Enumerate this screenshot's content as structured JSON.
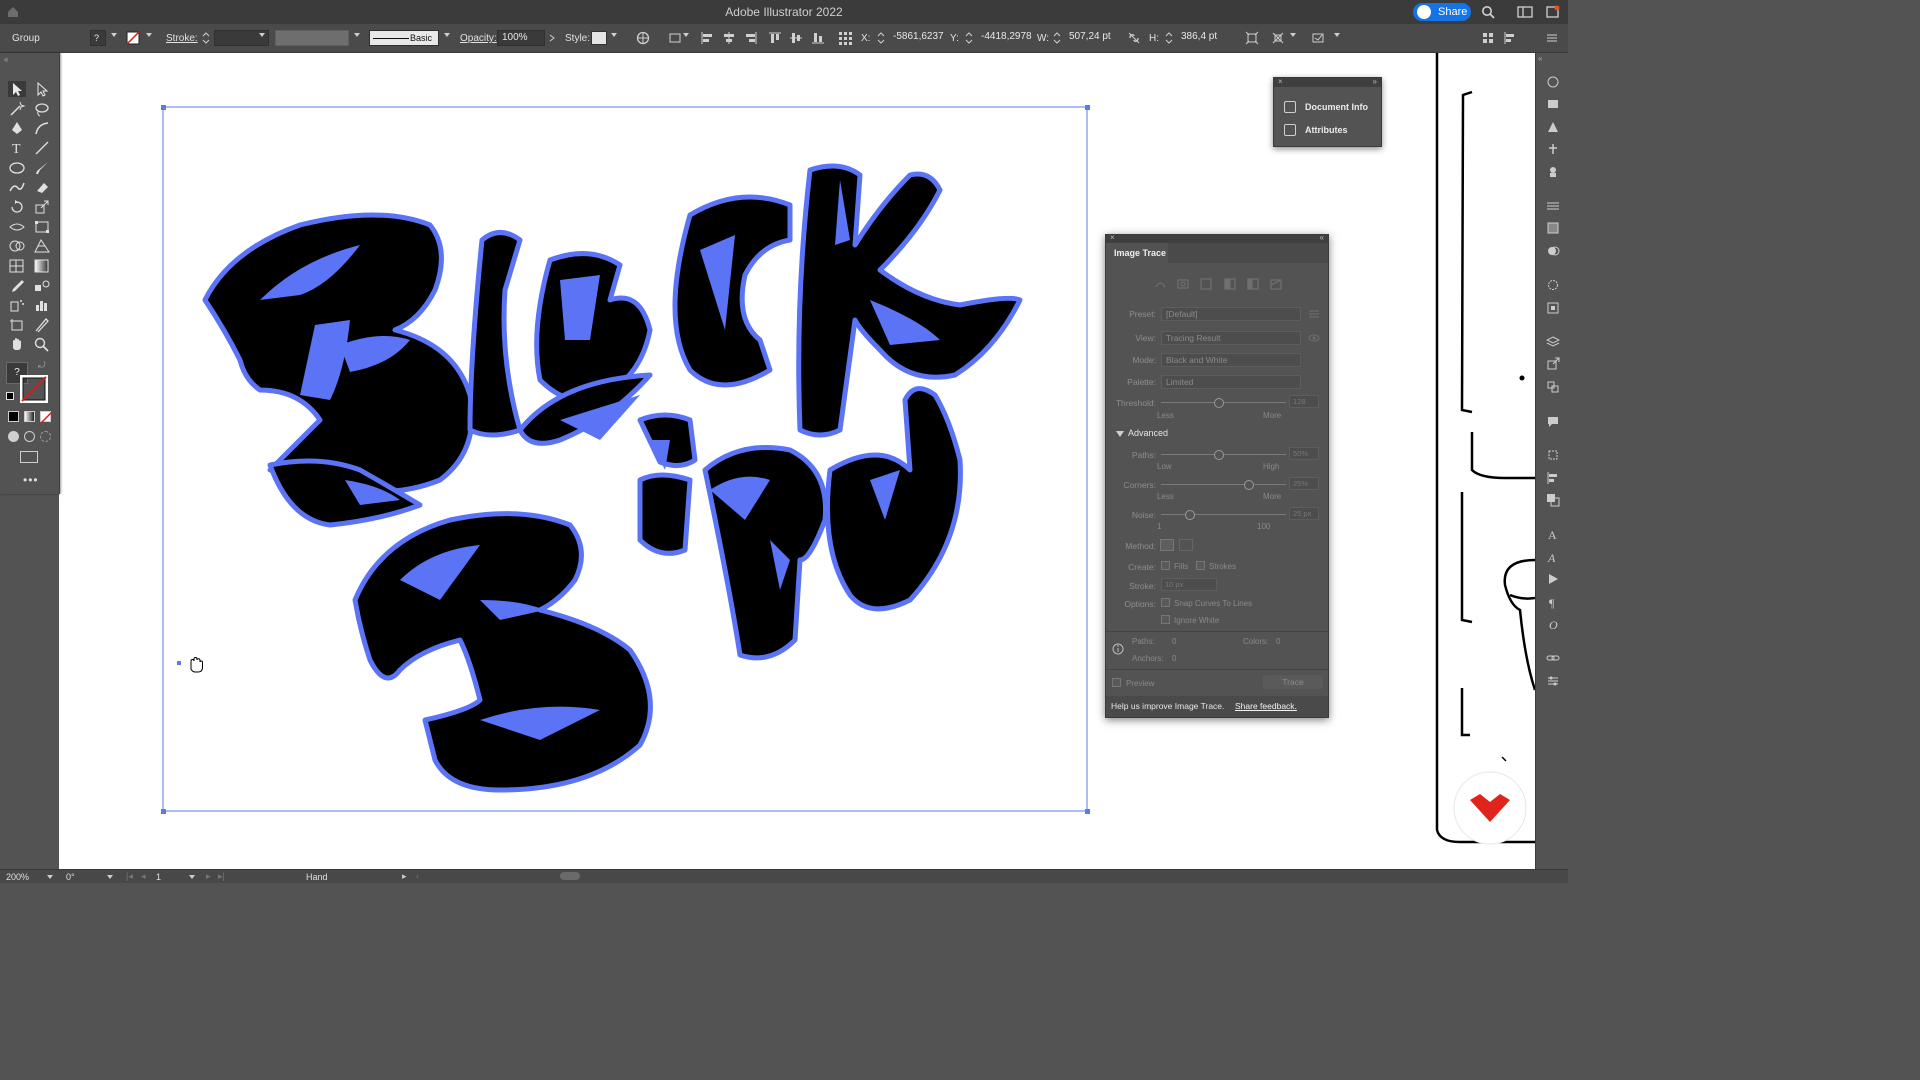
{
  "app": {
    "title": "Adobe Illustrator 2022",
    "share_label": "Share"
  },
  "control_bar": {
    "selection_type": "Group",
    "stroke_label": "Stroke:",
    "brush_label": "Basic",
    "opacity_label": "Opacity:",
    "opacity_value": "100%",
    "style_label": "Style:",
    "x_label": "X:",
    "x_value": "-5861,6237",
    "y_label": "Y:",
    "y_value": "-4418,2978",
    "w_label": "W:",
    "w_value": "507,24 pt",
    "h_label": "H:",
    "h_value": "386,4 pt"
  },
  "artwork": {
    "word_top": "Black",
    "word_bottom": "Bird",
    "fill_color": "#000000",
    "outline_color": "#5b73f5"
  },
  "mini_panel": {
    "items": [
      "Document Info",
      "Attributes"
    ]
  },
  "image_trace": {
    "title": "Image Trace",
    "preset_label": "Preset:",
    "preset_value": "[Default]",
    "view_label": "View:",
    "view_value": "Tracing Result",
    "mode_label": "Mode:",
    "mode_value": "Black and White",
    "palette_label": "Palette:",
    "palette_value": "Limited",
    "threshold_label": "Threshold:",
    "threshold_value": "128",
    "less": "Less",
    "more": "More",
    "advanced_label": "Advanced",
    "paths_label": "Paths:",
    "paths_value": "50%",
    "low": "Low",
    "high": "High",
    "corners_label": "Corners:",
    "corners_value": "25%",
    "noise_label": "Noise:",
    "noise_value": "25 px",
    "noise_min": "1",
    "noise_max": "100",
    "method_label": "Method:",
    "create_label": "Create:",
    "fills_label": "Fills",
    "strokes_label": "Strokes",
    "stroke_label": "Stroke:",
    "stroke_value": "10 px",
    "options_label": "Options:",
    "snap_label": "Snap Curves To Lines",
    "ignore_white_label": "Ignore White",
    "paths_count_label": "Paths:",
    "paths_count": "0",
    "colors_label": "Colors:",
    "colors_count": "0",
    "anchors_label": "Anchors:",
    "anchors_count": "0",
    "preview_label": "Preview",
    "trace_button": "Trace",
    "footer_text": "Help us improve Image Trace.",
    "footer_link": "Share feedback."
  },
  "status_bar": {
    "zoom": "200%",
    "rotation": "0°",
    "artboard": "1",
    "tool": "Hand"
  },
  "colors": {
    "accent": "#1473e6",
    "selection": "#5b7be8",
    "logo_red": "#e0241b"
  }
}
